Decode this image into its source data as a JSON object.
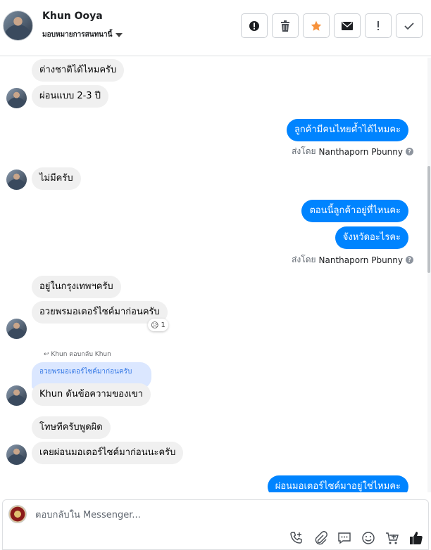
{
  "header": {
    "name": "Khun Ooya",
    "subtitle": "มอบหมายการสนทนานี้"
  },
  "toolbar": {
    "buttons": [
      "alert-icon",
      "trash-icon",
      "star-icon",
      "mail-icon",
      "exclamation-icon",
      "check-icon"
    ]
  },
  "messages": {
    "m1": "ต่างชาติได้ไหมครับ",
    "m2": "ผ่อนแบบ 2-3 ปี",
    "m3": "ลูกค้ามีคนไทยค้ำได้ไหมคะ",
    "sent_by_prefix": "ส่งโดย",
    "sent_by_name": "Nanthaporn Pbunny",
    "m4": "ไม่มีครับ",
    "m5": "ตอนนี้ลูกค้าอยู่ที่ไหนคะ",
    "m6": "จังหวัดอะไรคะ",
    "m7": "อยู่ในกรุงเทพฯครับ",
    "m8": "อวยพรมอเตอร์ไซค์มาก่อนครับ",
    "reaction_count": "1",
    "replied_label": "Khun ตอบกลับ Khun",
    "quoted": "อวยพรมอเตอร์ไซค์มาก่อนครับ",
    "m9": "Khun ดันข้อความของเขา",
    "m10": "โทษทีครับพูดผิด",
    "m11": "เคยผ่อนมอเตอร์ไซค์มาก่อนนะครับ",
    "m12": "ผ่อนมอเตอร์ไซค์มาอยู่ใช่ไหมคะ"
  },
  "composer": {
    "placeholder": "ตอบกลับใน Messenger..."
  },
  "colors": {
    "outgoing": "#0084ff",
    "incoming": "#f0f0f0",
    "accent_star": "#f7923b"
  }
}
